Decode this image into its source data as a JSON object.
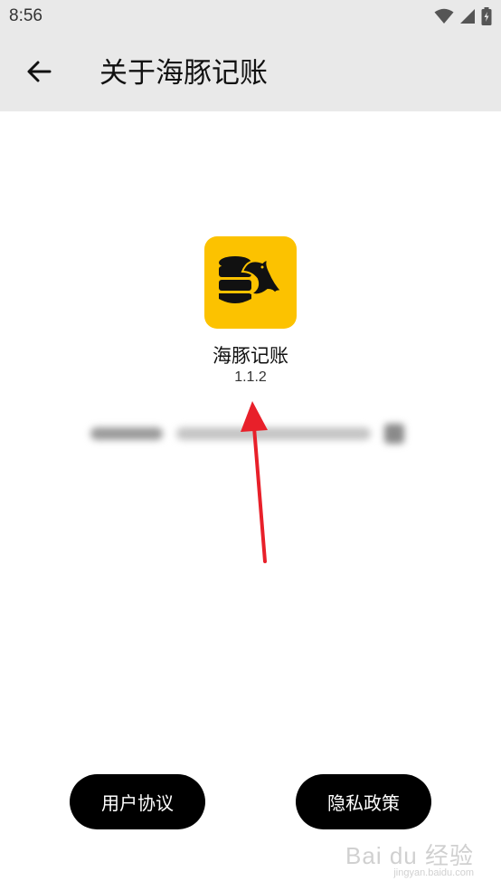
{
  "status_bar": {
    "time": "8:56",
    "icons": [
      "wifi-icon",
      "signal-icon",
      "battery-charging-icon"
    ]
  },
  "app_bar": {
    "back_icon": "arrow-left-icon",
    "title": "关于海豚记账"
  },
  "app": {
    "name": "海豚记账",
    "version": "1.1.2",
    "icon": "dolphin-coins-icon",
    "icon_color": "#fcc200"
  },
  "buttons": {
    "user_agreement": "用户协议",
    "privacy_policy": "隐私政策"
  },
  "watermark": {
    "main": "Bai du 经验",
    "sub": "jingyan.baidu.com"
  },
  "colors": {
    "app_bar_bg": "#e9e9e9",
    "button_bg": "#000000",
    "annotation_arrow": "#e8202a"
  }
}
